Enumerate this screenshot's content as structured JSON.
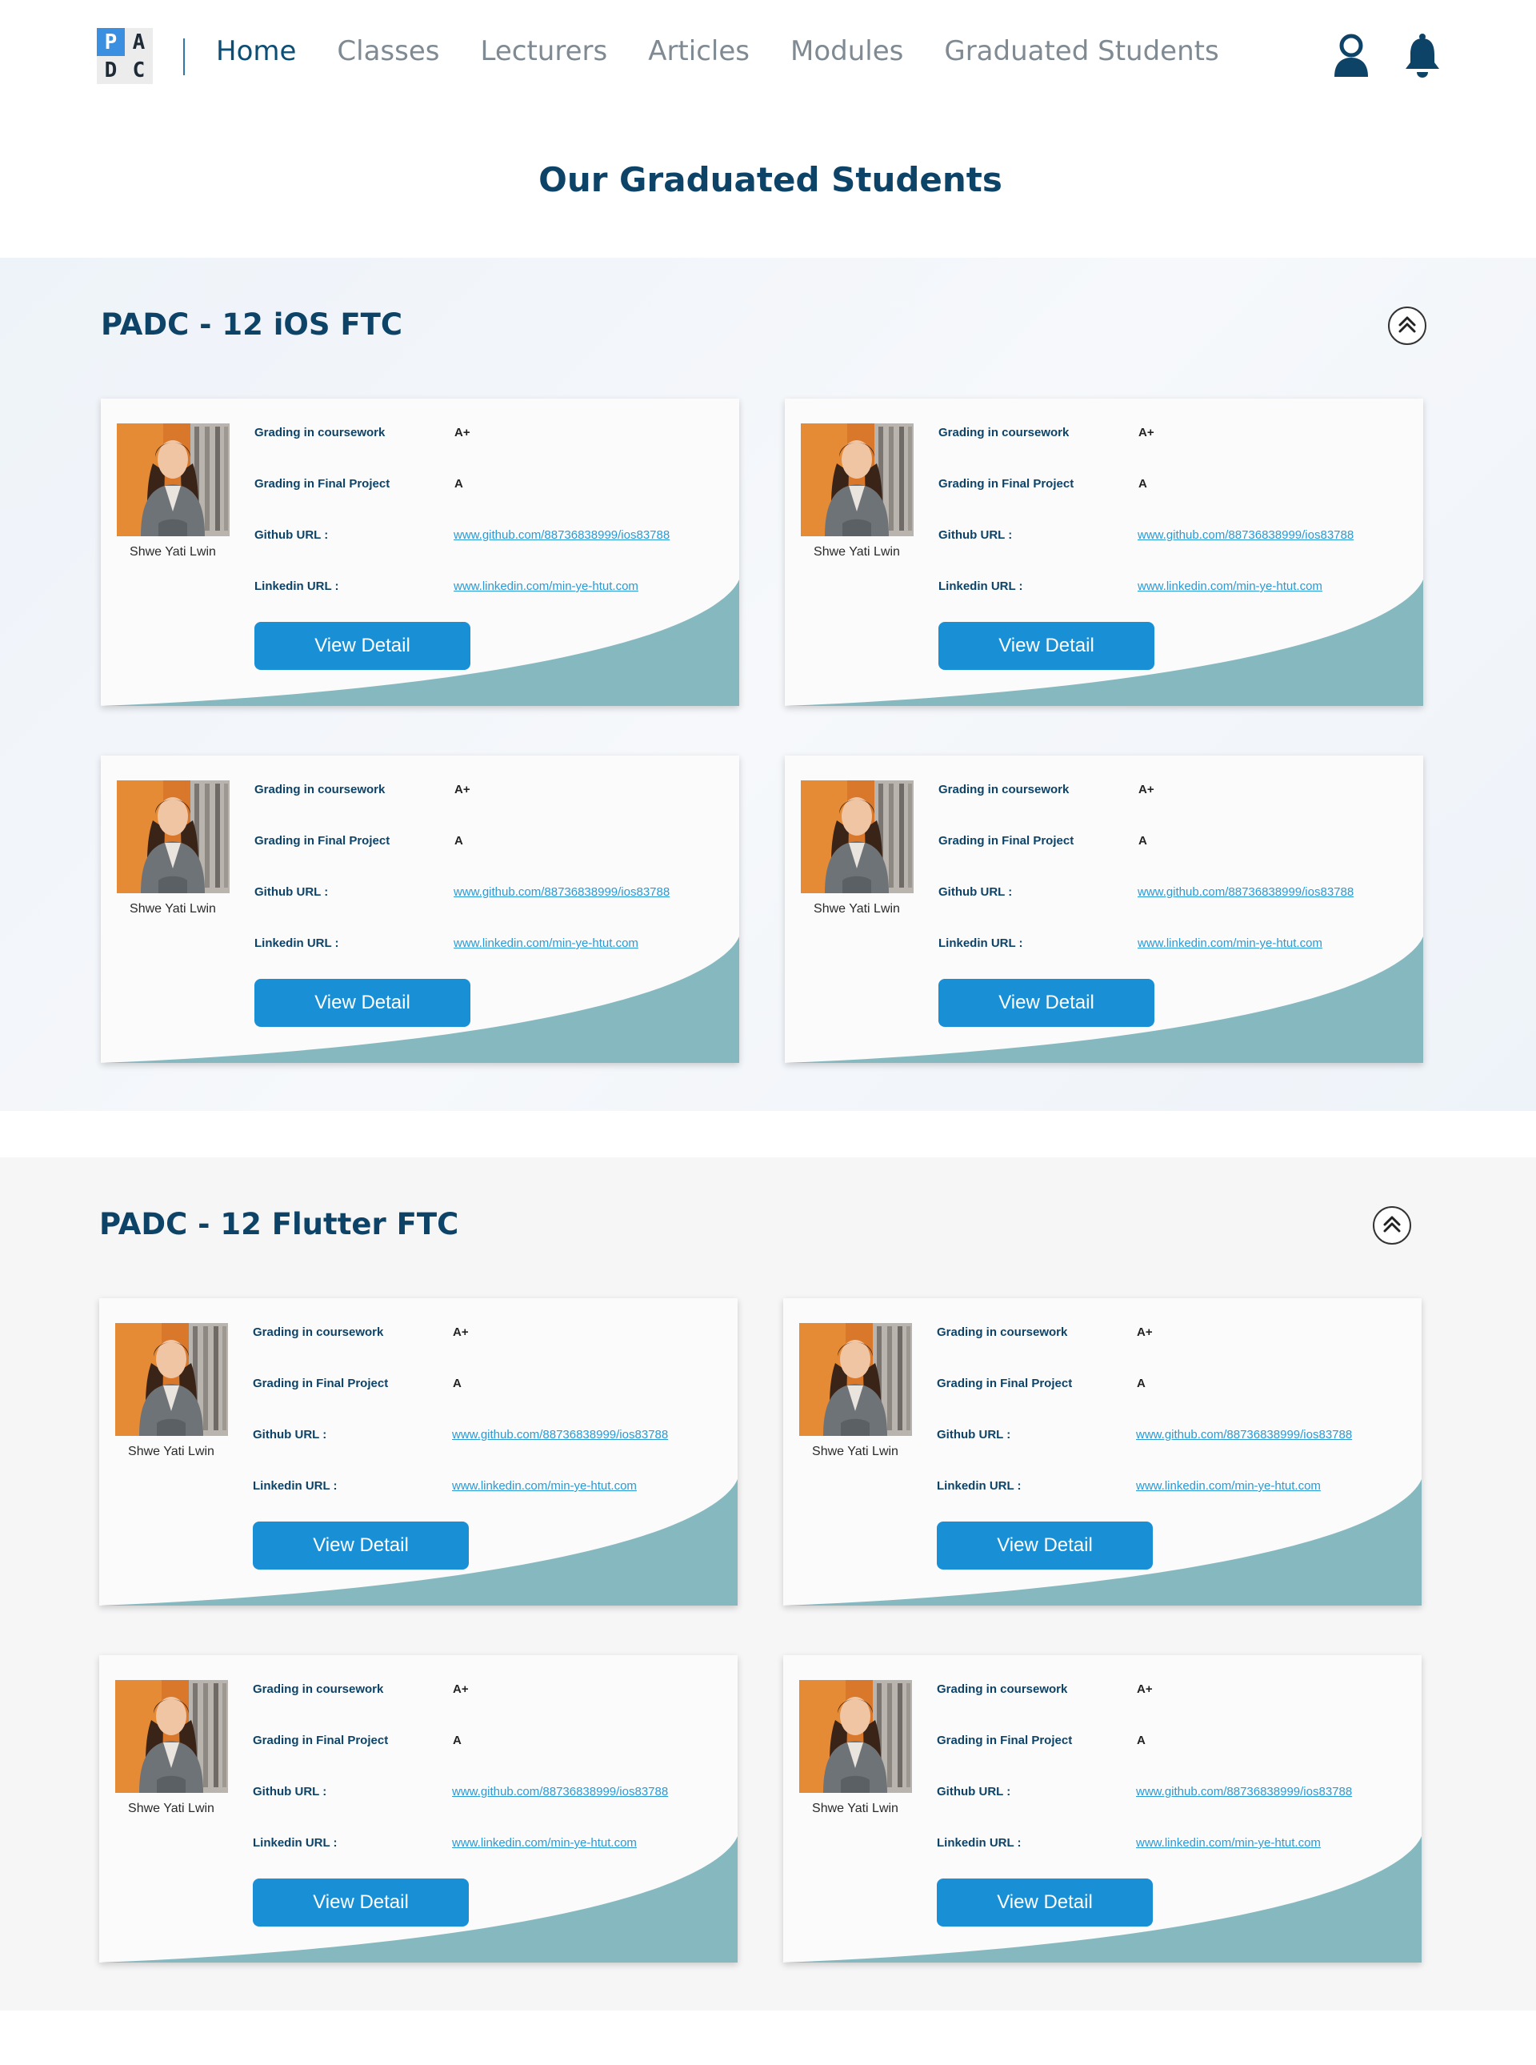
{
  "logo": {
    "letters": [
      "P",
      "A",
      "D",
      "C"
    ]
  },
  "nav": [
    {
      "label": "Home",
      "active": true
    },
    {
      "label": "Classes",
      "active": false
    },
    {
      "label": "Lecturers",
      "active": false
    },
    {
      "label": "Articles",
      "active": false
    },
    {
      "label": "Modules",
      "active": false
    },
    {
      "label": "Graduated Students",
      "active": false
    }
  ],
  "header_icons": [
    "user-icon",
    "bell-icon"
  ],
  "page_title": "Our Graduated Students",
  "colors": {
    "primary": "#0e4368",
    "button": "#1990d6",
    "link": "#2a9ad6",
    "wave": "#86b8bf",
    "nav_inactive": "#7f8a93"
  },
  "card_labels": {
    "coursework": "Grading in coursework",
    "final_project": "Grading in Final Project",
    "github": "Github URL :",
    "linkedin": "Linkedin URL :",
    "button": "View Detail"
  },
  "sections": [
    {
      "title": "PADC - 12 iOS FTC",
      "students": [
        {
          "name": "Shwe Yati Lwin",
          "coursework_grade": "A+",
          "final_project_grade": "A",
          "github": "www.github.com/88736838999/ios83788",
          "linkedin": "www.linkedin.com/min-ye-htut.com"
        },
        {
          "name": "Shwe Yati Lwin",
          "coursework_grade": "A+",
          "final_project_grade": "A",
          "github": "www.github.com/88736838999/ios83788",
          "linkedin": "www.linkedin.com/min-ye-htut.com"
        },
        {
          "name": "Shwe Yati Lwin",
          "coursework_grade": "A+",
          "final_project_grade": "A",
          "github": "www.github.com/88736838999/ios83788",
          "linkedin": "www.linkedin.com/min-ye-htut.com"
        },
        {
          "name": "Shwe Yati Lwin",
          "coursework_grade": "A+",
          "final_project_grade": "A",
          "github": "www.github.com/88736838999/ios83788",
          "linkedin": "www.linkedin.com/min-ye-htut.com"
        }
      ]
    },
    {
      "title": "PADC - 12 Flutter FTC",
      "students": [
        {
          "name": "Shwe Yati Lwin",
          "coursework_grade": "A+",
          "final_project_grade": "A",
          "github": "www.github.com/88736838999/ios83788",
          "linkedin": "www.linkedin.com/min-ye-htut.com"
        },
        {
          "name": "Shwe Yati Lwin",
          "coursework_grade": "A+",
          "final_project_grade": "A",
          "github": "www.github.com/88736838999/ios83788",
          "linkedin": "www.linkedin.com/min-ye-htut.com"
        },
        {
          "name": "Shwe Yati Lwin",
          "coursework_grade": "A+",
          "final_project_grade": "A",
          "github": "www.github.com/88736838999/ios83788",
          "linkedin": "www.linkedin.com/min-ye-htut.com"
        },
        {
          "name": "Shwe Yati Lwin",
          "coursework_grade": "A+",
          "final_project_grade": "A",
          "github": "www.github.com/88736838999/ios83788",
          "linkedin": "www.linkedin.com/min-ye-htut.com"
        }
      ]
    }
  ]
}
